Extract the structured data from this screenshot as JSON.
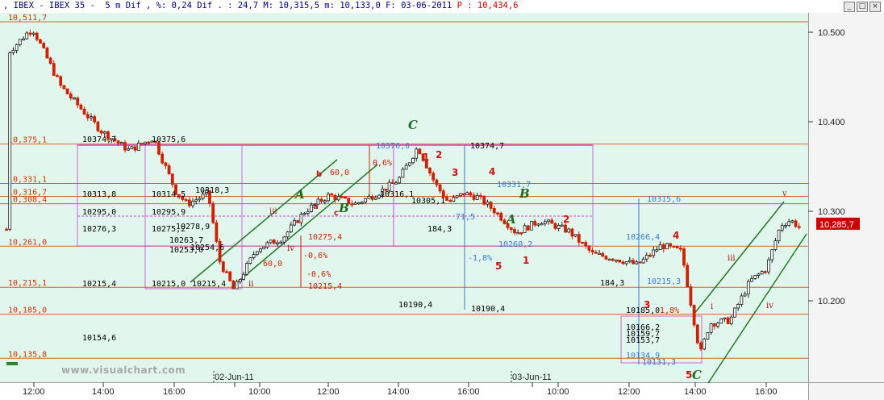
{
  "window": {
    "title_segments": [
      ", IBEX - IBEX 35 -  5 m Dif , %: 0,24 Dif . : 24,7 M: 10,315,5 m: 10,133,0 F: 03-06-2011 ",
      "P : 10,434,6"
    ],
    "buttons": [
      "_",
      "□",
      "×"
    ]
  },
  "watermark": "www.visualchart.com",
  "colors": {
    "plot_bg": "#e1f7ee",
    "candle_up": "#1a1a1a",
    "candle_down": "#cc2200",
    "level_line": "#e06020",
    "channel": "#1f7a1f",
    "magenta": "#cc44cc",
    "last_price_bg": "#cc0000"
  },
  "chart_data": {
    "type": "candlestick",
    "instrument": "IBEX 35",
    "timeframe": "5 m",
    "last_price_label": "10,285,7",
    "y_ticks": [
      "10.500",
      "10.400",
      "10.300",
      "10.200"
    ],
    "x_ticks": [
      "12:00",
      "14:00",
      "16:00",
      "02-Jun-11",
      "10:00",
      "12:00",
      "14:00",
      "16:00",
      "03-Jun-11",
      "10:00",
      "12:00",
      "14:00",
      "16:00"
    ],
    "levels": [
      {
        "label": "10,511,7",
        "value": 10511.7
      },
      {
        "label": "10,375,1",
        "value": 10375.1
      },
      {
        "label": "10,331,1",
        "value": 10331.1
      },
      {
        "label": "10,316,7",
        "value": 10316.7
      },
      {
        "label": "10,308,4",
        "value": 10308.4
      },
      {
        "label": "10,261,0",
        "value": 10261.0
      },
      {
        "label": "10,215,1",
        "value": 10215.1
      },
      {
        "label": "10,185,0",
        "value": 10185.0
      },
      {
        "label": "10,135,8",
        "value": 10135.8
      }
    ],
    "wave_labels": {
      "green": [
        "C",
        "A",
        "B",
        "B",
        "A",
        "C"
      ],
      "red": [
        "1",
        "2",
        "3",
        "4",
        "5",
        "1",
        "2",
        "3",
        "4",
        "5",
        "c",
        "a",
        "b"
      ],
      "roman": [
        "ii",
        "iii",
        "iv",
        "i",
        "iii",
        "iv",
        "v"
      ]
    },
    "annotations": [
      "10374,7",
      "10375,6",
      "10313,8",
      "10314,5",
      "10318,3",
      "10295,0",
      "10295,9",
      "10278,9",
      "10276,3",
      "10275,2",
      "10263,7",
      "10254,6",
      "10253,0",
      "10215,4",
      "10215,0",
      "10215,4",
      "60,0",
      "0,6%",
      "60,0",
      "-0,6%",
      "-0,6%",
      "10275,4",
      "10215,4",
      "10376,0",
      "10374,7",
      "10331,7",
      "10315,6",
      "10316,1",
      "10305,1",
      "184,3",
      "-1,8%",
      "10260,2",
      "10190,4",
      "10190,4",
      "10266,4",
      "184,3",
      "10215,3",
      "10185,0",
      "10166,2",
      "10159,7",
      "10153,7",
      "10134,9",
      "10131,3",
      "10154,6",
      "71,5",
      "1,8%"
    ]
  }
}
